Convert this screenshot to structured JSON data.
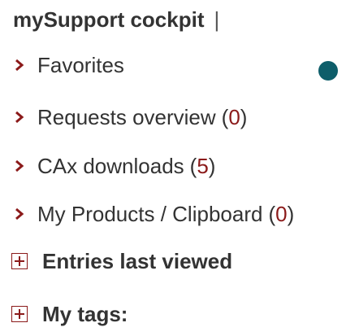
{
  "header": {
    "title": "mySupport cockpit",
    "separator": "|"
  },
  "status_dot": {
    "color": "#0e5e6a"
  },
  "nav": {
    "items": [
      {
        "label": "Favorites",
        "icon": "chevron-right-icon"
      },
      {
        "label": "Requests overview",
        "count": "0",
        "icon": "chevron-right-icon"
      },
      {
        "label": "CAx downloads",
        "count": "5",
        "icon": "chevron-right-icon"
      },
      {
        "label": "My Products / Clipboard",
        "count": "0",
        "icon": "chevron-right-icon"
      }
    ]
  },
  "sections": {
    "items": [
      {
        "label": "Entries last viewed",
        "icon": "expand-plus-icon"
      },
      {
        "label": "My tags:",
        "icon": "expand-plus-icon"
      }
    ]
  },
  "colors": {
    "accent": "#8b1a1a",
    "text": "#333333",
    "dot": "#0e5e6a"
  }
}
